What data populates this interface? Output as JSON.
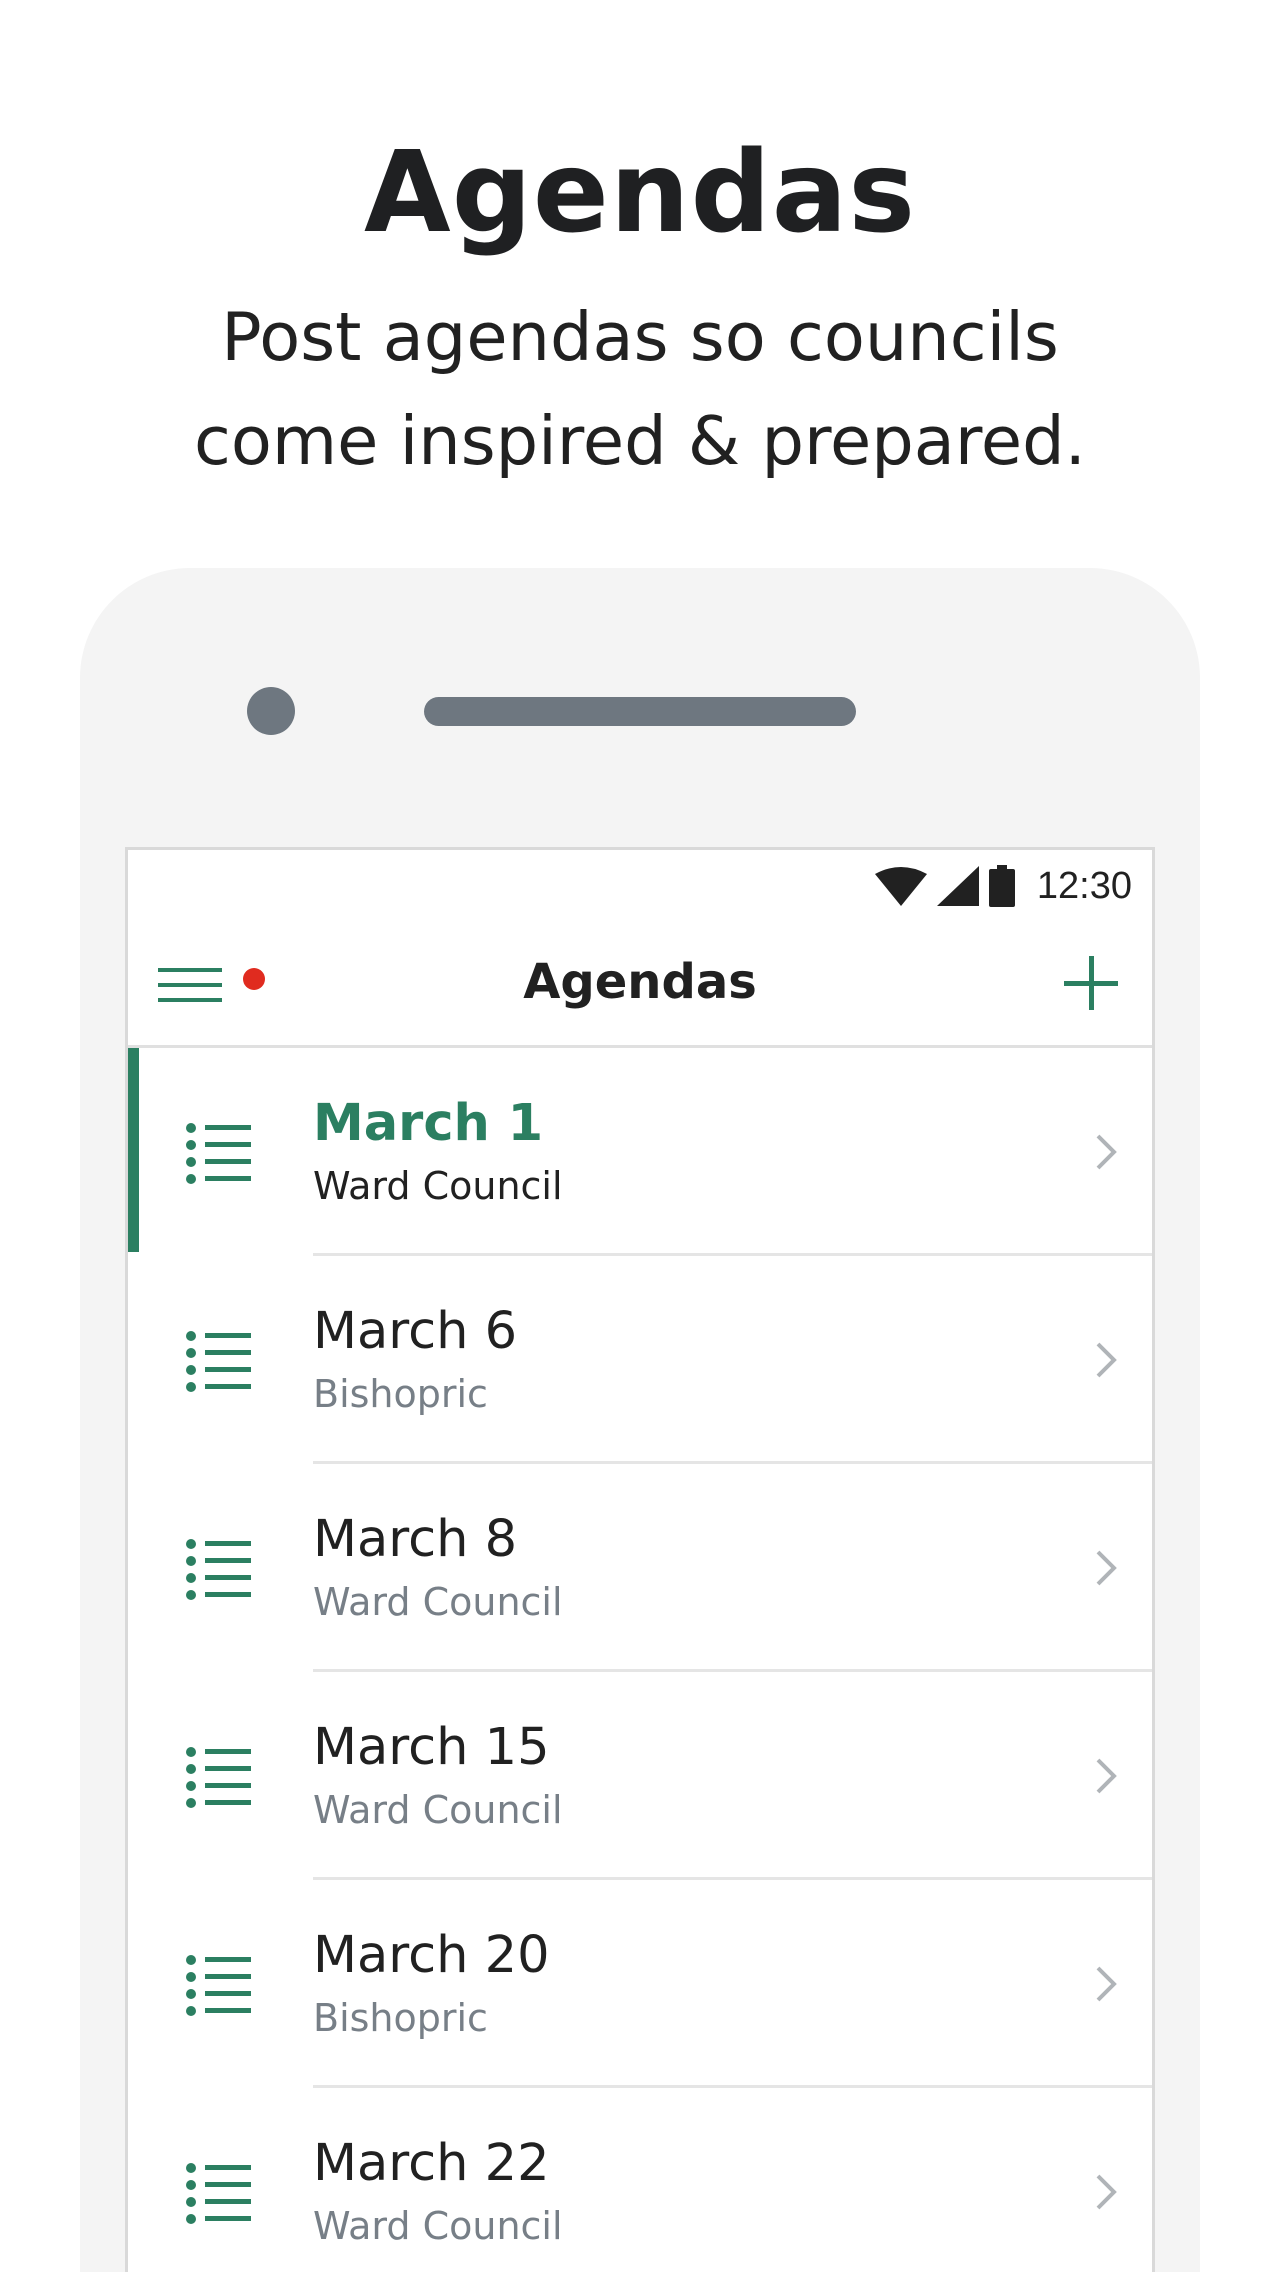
{
  "hero": {
    "title": "Agendas",
    "subtitle_lines": [
      "Post agendas so councils",
      "come inspired & prepared."
    ]
  },
  "status_bar": {
    "time": "12:30",
    "icons": [
      "wifi-icon",
      "cell-signal-icon",
      "battery-icon"
    ]
  },
  "app_bar": {
    "title": "Agendas",
    "menu_icon": "hamburger-menu-icon",
    "menu_has_notification": true,
    "add_icon": "plus-icon"
  },
  "agendas": [
    {
      "title": "March 1",
      "subtitle": "Ward Council",
      "selected": true
    },
    {
      "title": "March 6",
      "subtitle": "Bishopric",
      "selected": false
    },
    {
      "title": "March 8",
      "subtitle": "Ward Council",
      "selected": false
    },
    {
      "title": "March 15",
      "subtitle": "Ward Council",
      "selected": false
    },
    {
      "title": "March 20",
      "subtitle": "Bishopric",
      "selected": false
    },
    {
      "title": "March 22",
      "subtitle": "Ward Council",
      "selected": false
    }
  ],
  "colors": {
    "accent": "#2b7f61",
    "notification": "#e02b1f",
    "secondary_text": "#777f87",
    "phone_body": "#f4f4f4",
    "phone_details": "#6e7780"
  }
}
